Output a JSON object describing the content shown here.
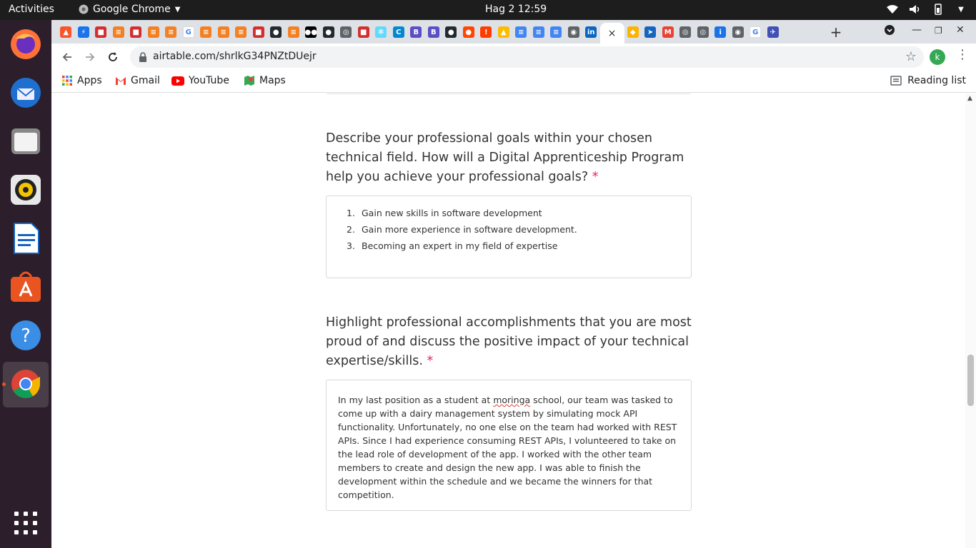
{
  "topbar": {
    "activities": "Activities",
    "app_name": "Google Chrome",
    "clock": "Hag 2  12:59"
  },
  "dock": {
    "items": [
      "firefox",
      "thunderbird",
      "files",
      "rhythmbox",
      "libreoffice-writer",
      "ubuntu-software",
      "help",
      "chrome"
    ]
  },
  "tabs": {
    "favicons": [
      "brave",
      "bolt",
      "shield",
      "stack",
      "shield",
      "stack",
      "stack",
      "google",
      "stack",
      "stack",
      "stack",
      "shield",
      "github",
      "stack",
      "medium",
      "github",
      "globe",
      "shield",
      "react",
      "c",
      "b",
      "b",
      "github",
      "reddit",
      "alert",
      "drive",
      "docs",
      "docs",
      "docs",
      "chrome",
      "linkedin"
    ],
    "active_close": "×",
    "after_active": [
      "airtable",
      "arrow",
      "gmail",
      "globe",
      "globe",
      "info",
      "chrome",
      "google",
      "plane"
    ],
    "new_tab": "+"
  },
  "toolbar": {
    "url": "airtable.com/shrlkG34PNZtDUejr",
    "profile_initial": "k"
  },
  "bookmarks": {
    "items": [
      {
        "label": "Apps"
      },
      {
        "label": "Gmail"
      },
      {
        "label": "YouTube"
      },
      {
        "label": "Maps"
      }
    ],
    "reading_list": "Reading list"
  },
  "form": {
    "q1": {
      "text": "Describe your professional goals within your chosen technical field. How will a Digital Apprenticeship Program help you achieve your professional goals?",
      "required_mark": "*",
      "answers": [
        {
          "num": "1.",
          "text": "Gain new skills in software development"
        },
        {
          "num": "2.",
          "text": "Gain more experience in software development."
        },
        {
          "num": "3.",
          "text": "Becoming an expert in my field of expertise"
        }
      ]
    },
    "q2": {
      "text": "Highlight professional accomplishments that you are most proud of and discuss the positive impact of your technical expertise/skills.",
      "required_mark": "*",
      "answer_before": "In my last position as a student at ",
      "answer_misspelled": "moringa",
      "answer_after": " school, our team was tasked to come up with a dairy management system by simulating mock API functionality. Unfortunately, no one else on the team had worked with REST APIs. Since I had experience consuming REST APIs, I volunteered to take on the lead role of development of the app. I worked with the other team members to create and design the new app. I was able to finish the development within the schedule and we became the winners for that competition."
    }
  },
  "colors": {
    "required": "#e0245e",
    "dock_bg": "#2c1f2b",
    "topbar_bg": "#1d1d1d",
    "tabstrip_bg": "#dee1e6"
  }
}
